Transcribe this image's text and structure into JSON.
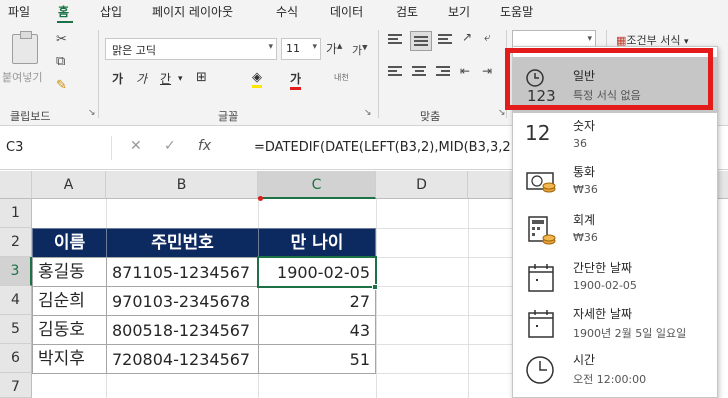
{
  "ribbon_tabs": [
    "파일",
    "홈",
    "삽입",
    "페이지 레이아웃",
    "수식",
    "데이터",
    "검토",
    "보기",
    "도움말"
  ],
  "clipboard": {
    "paste_label": "붙여넣기",
    "group_label": "클립보드"
  },
  "font": {
    "family": "맑은 고딕",
    "size": "11",
    "bold": "가",
    "italic": "가",
    "underline": "간",
    "color_btn": "가",
    "phonetic": "내천",
    "grow": "가",
    "shrink": "가",
    "group_label": "글꼴"
  },
  "alignment": {
    "group_label": "맞춤"
  },
  "styles": {
    "conditional_format": "조건부 서식"
  },
  "formula_bar": {
    "name_box": "C3",
    "cancel_icon": "✕",
    "enter_icon": "✓",
    "fx": "fx",
    "formula": "=DATEDIF(DATE(LEFT(B3,2),MID(B3,3,2"
  },
  "grid": {
    "columns": [
      "A",
      "B",
      "C",
      "D"
    ],
    "rows": [
      "1",
      "2",
      "3",
      "4",
      "5",
      "6",
      "7"
    ],
    "headers": [
      "이름",
      "주민번호",
      "만 나이"
    ],
    "data": [
      {
        "name": "홍길동",
        "id": "871105-1234567",
        "age": "1900-02-05"
      },
      {
        "name": "김순희",
        "id": "970103-2345678",
        "age": "27"
      },
      {
        "name": "김동호",
        "id": "800518-1234567",
        "age": "43"
      },
      {
        "name": "박지후",
        "id": "720804-1234567",
        "age": "51"
      }
    ]
  },
  "number_format_menu": [
    {
      "title": "일반",
      "subtitle": "특정 서식 없음",
      "icon": "clock-123-icon"
    },
    {
      "title": "숫자",
      "subtitle": "36",
      "icon": "number-12-icon"
    },
    {
      "title": "통화",
      "subtitle": "₩36",
      "icon": "currency-icon"
    },
    {
      "title": "회계",
      "subtitle": "₩36",
      "icon": "accounting-icon"
    },
    {
      "title": "간단한 날짜",
      "subtitle": "1900-02-05",
      "icon": "calendar-icon"
    },
    {
      "title": "자세한 날짜",
      "subtitle": "1900년 2월 5일 일요일",
      "icon": "calendar-icon"
    },
    {
      "title": "시간",
      "subtitle": "오전 12:00:00",
      "icon": "clock-icon"
    }
  ],
  "colors": {
    "accent_green": "#1e7145",
    "header_navy": "#0d2a60",
    "highlight_red": "#e41b1b"
  }
}
